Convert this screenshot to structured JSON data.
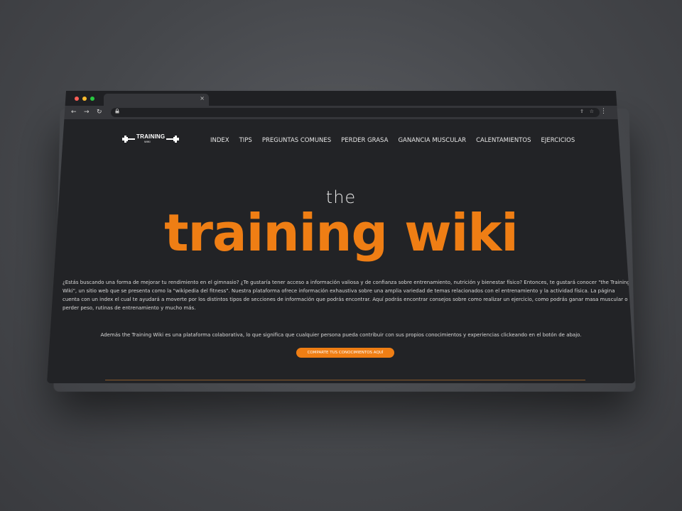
{
  "browser": {
    "tab_close": "×",
    "back": "←",
    "forward": "→",
    "reload": "↻",
    "lock": "🔒",
    "share": "⇪",
    "star": "☆",
    "menu": "⋮"
  },
  "site": {
    "logo_text": "TRAINING",
    "logo_sub": "WIKI",
    "nav": [
      "INDEX",
      "TIPS",
      "PREGUNTAS COMUNES",
      "PERDER GRASA",
      "GANANCIA MUSCULAR",
      "CALENTAMIENTOS",
      "EJERCICIOS"
    ],
    "hero_the": "the",
    "hero_title": "training wiki",
    "intro": "¿Estás buscando una forma de mejorar tu rendimiento en el gimnasio? ¿Te gustaría tener acceso a información valiosa y de confianza sobre entrenamiento, nutrición y bienestar físico? Entonces, te gustará conocer \"the Training Wiki\", un sitio web que se presenta como la \"wikipedia del fitness\". Nuestra plataforma ofrece información exhaustiva sobre una amplia variedad de temas relacionados con el entrenamiento y la actividad física. La página cuenta con un index el cual te ayudará a moverte por los distintos tipos de secciones de información que podrás encontrar. Aquí podrás encontrar consejos sobre como realizar un ejercicio, como podrás ganar masa muscular o perder peso, rutinas de entrenamiento y mucho más.",
    "collab": "Además the Training Wiki es una plataforma colaborativa, lo que significa que cualquier persona pueda contribuir con sus propios conocimientos y experiencias clickeando en el botón de abajo.",
    "cta": "COMPARTE TUS CONOCIMIENTOS AQUÍ"
  },
  "colors": {
    "accent": "#ef7e14",
    "background": "#222326"
  }
}
